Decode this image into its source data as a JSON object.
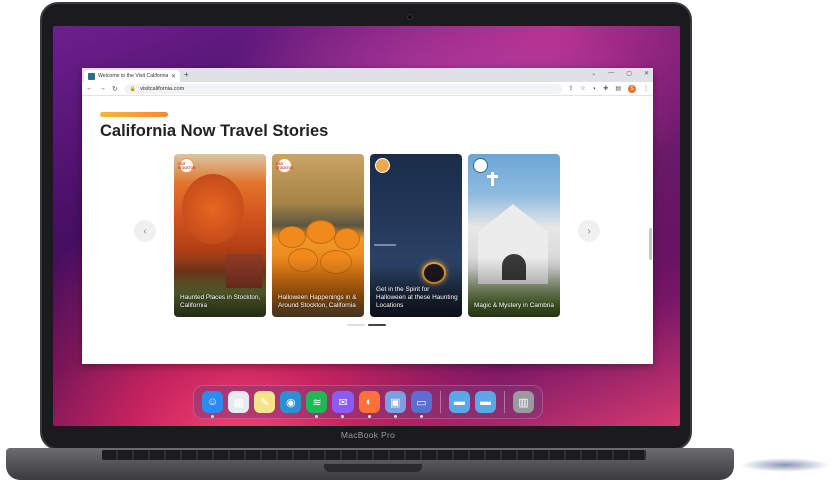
{
  "device": {
    "brand_label": "MacBook Pro"
  },
  "browser": {
    "tab_title": "Welcome to the Visit California",
    "url": "visitcalifornia.com",
    "profile_initial": "S"
  },
  "page": {
    "heading": "California Now Travel Stories",
    "cards": [
      {
        "caption": "Haunted Places in Stockton, California",
        "badge": "VISIT STOCKTON"
      },
      {
        "caption": "Halloween Happenings in & Around Stockton, California",
        "badge": "VISIT STOCKTON"
      },
      {
        "caption": "Get in the Spirit for Halloween at these Haunting Locations",
        "badge": ""
      },
      {
        "caption": "Magic & Mystery in Cambria",
        "badge": ""
      }
    ],
    "pagination_active": 2,
    "pagination_total": 2
  },
  "dock": {
    "items": [
      {
        "name": "finder",
        "icon": "finder-icon",
        "color": "#2a8cf0",
        "running": true
      },
      {
        "name": "launchpad",
        "icon": "launchpad-icon",
        "color": "#e9e9ef",
        "running": false
      },
      {
        "name": "notes",
        "icon": "notes-icon",
        "color": "#f5e58a",
        "running": false
      },
      {
        "name": "quicktime",
        "icon": "quicktime-icon",
        "color": "#2b8fd6",
        "running": false
      },
      {
        "name": "spotify",
        "icon": "spotify-icon",
        "color": "#1db954",
        "running": true
      },
      {
        "name": "messenger",
        "icon": "messenger-icon",
        "color": "#8a5cf5",
        "running": true
      },
      {
        "name": "firefox",
        "icon": "firefox-icon",
        "color": "#ff7139",
        "running": true
      },
      {
        "name": "preview",
        "icon": "preview-icon",
        "color": "#7aa0e0",
        "running": true
      },
      {
        "name": "app-grid",
        "icon": "window-icon",
        "color": "#5a6fd0",
        "running": true
      },
      {
        "name": "folder-1",
        "icon": "folder-icon",
        "color": "#5aa8e8",
        "running": false
      },
      {
        "name": "folder-2",
        "icon": "folder-icon",
        "color": "#5aa8e8",
        "running": false
      },
      {
        "name": "trash",
        "icon": "trash-icon",
        "color": "#9a9aa0",
        "running": false
      }
    ]
  }
}
